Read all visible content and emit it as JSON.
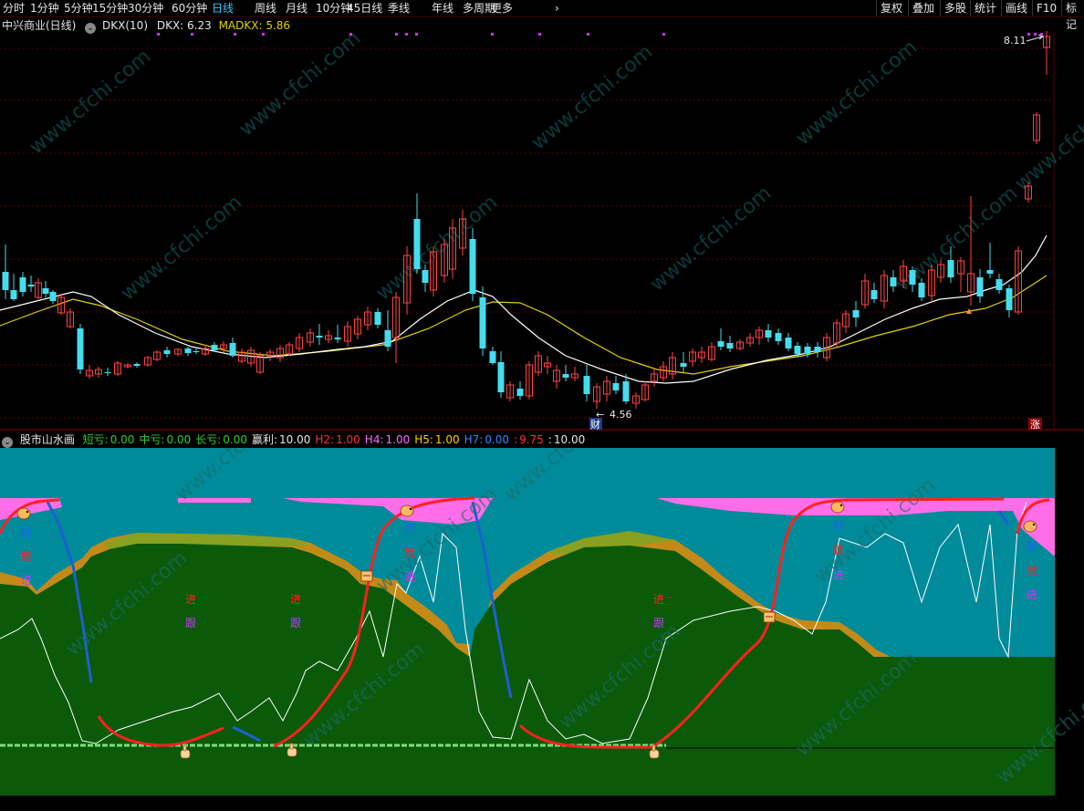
{
  "toolbar": {
    "periods": [
      "分时",
      "1分钟",
      "5分钟",
      "15分钟",
      "30分钟",
      "60分钟",
      "日线",
      "周线",
      "月线",
      "10分钟",
      "45日线",
      "季线",
      "年线",
      "多周期",
      "更多"
    ],
    "active_period": "日线",
    "right_buttons": [
      "复权",
      "叠加",
      "多股",
      "统计",
      "画线",
      "F10",
      "标记"
    ]
  },
  "main_panel": {
    "stock_name": "中兴商业(日线)",
    "indicator_name": "DKX(10)",
    "dkx_label": "DKX:",
    "dkx_value": "6.23",
    "madkx_label": "MADKX:",
    "madkx_value": "5.86",
    "high_price_label": "8.11",
    "low_price_label": "4.56",
    "badge_cai": "财",
    "badge_zhang": "涨"
  },
  "indicator_panel": {
    "name": "股市山水画",
    "items": [
      {
        "label": "短亏:",
        "value": "0.00",
        "color": "#33cc33"
      },
      {
        "label": "中亏:",
        "value": "0.00",
        "color": "#33cc33"
      },
      {
        "label": "长亏:",
        "value": "0.00",
        "color": "#33cc33"
      },
      {
        "label": "赢利:",
        "value": "10.00",
        "color": "#e6e6e6"
      },
      {
        "label": "H2:",
        "value": "1.00",
        "color": "#ff3333"
      },
      {
        "label": "H4:",
        "value": "1.00",
        "color": "#ff66ff"
      },
      {
        "label": "H5:",
        "value": "1.00",
        "color": "#ffcc00"
      },
      {
        "label": "H7:",
        "value": "0.00",
        "color": "#3388ff"
      },
      {
        "label": ":",
        "value": "9.75",
        "color": "#ff3333"
      },
      {
        "label": ":",
        "value": "10.00",
        "color": "#e6e6e6"
      }
    ],
    "annotations": {
      "hao": "好",
      "jiu": "就",
      "jin": "进",
      "gen": "跟"
    }
  },
  "watermark": "www.cfchi.com",
  "colors": {
    "up_candle": "#ff4444",
    "down_candle": "#44ddee",
    "dkx_line": "#ffffff",
    "madkx_line": "#e0d000",
    "grid": "#5a0000",
    "panel_bg_teal": "#008b9a",
    "panel_green": "#0a5a0a",
    "active_tab": "#39c6ff"
  }
}
